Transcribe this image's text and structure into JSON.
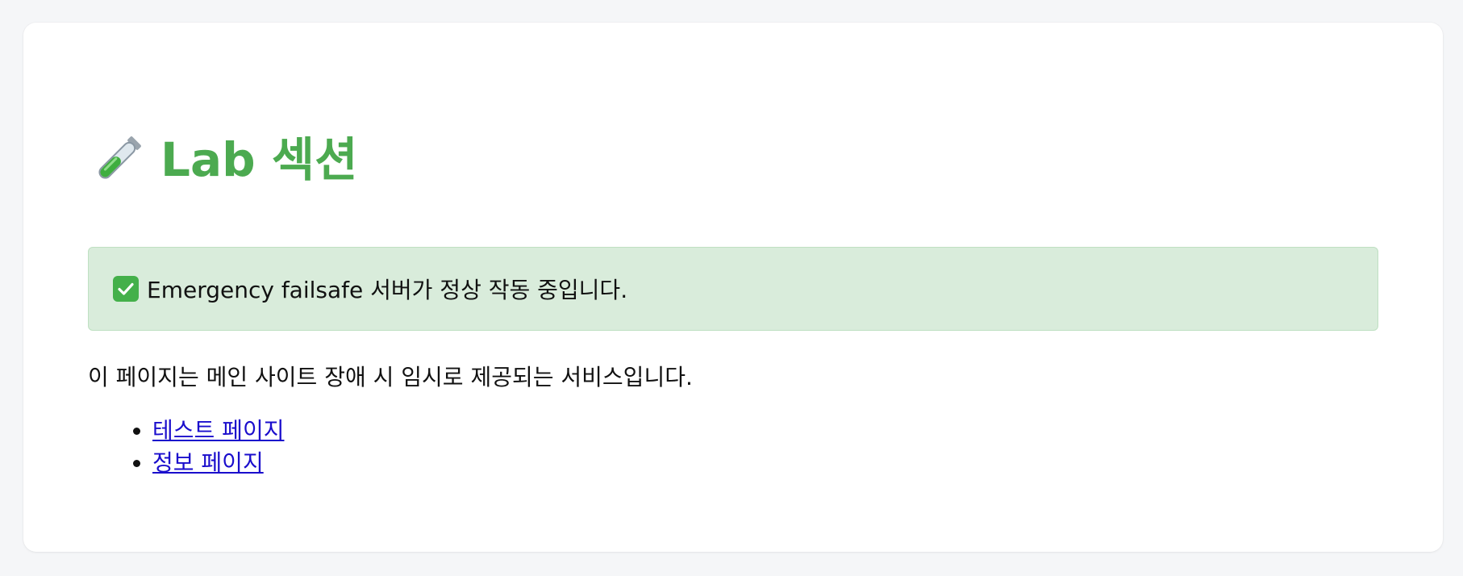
{
  "header": {
    "title": "Lab 섹션",
    "title_icon": "test-tube-icon",
    "title_color": "#4caa50"
  },
  "alert": {
    "icon": "check-mark-icon",
    "message": "Emergency failsafe 서버가 정상 작동 중입니다.",
    "background": "#d9ecdb"
  },
  "main": {
    "description": "이 페이지는 메인 사이트 장애 시 임시로 제공되는 서비스입니다.",
    "links": [
      {
        "label": "테스트 페이지"
      },
      {
        "label": "정보 페이지"
      }
    ],
    "link_color": "#1a0dcc"
  }
}
